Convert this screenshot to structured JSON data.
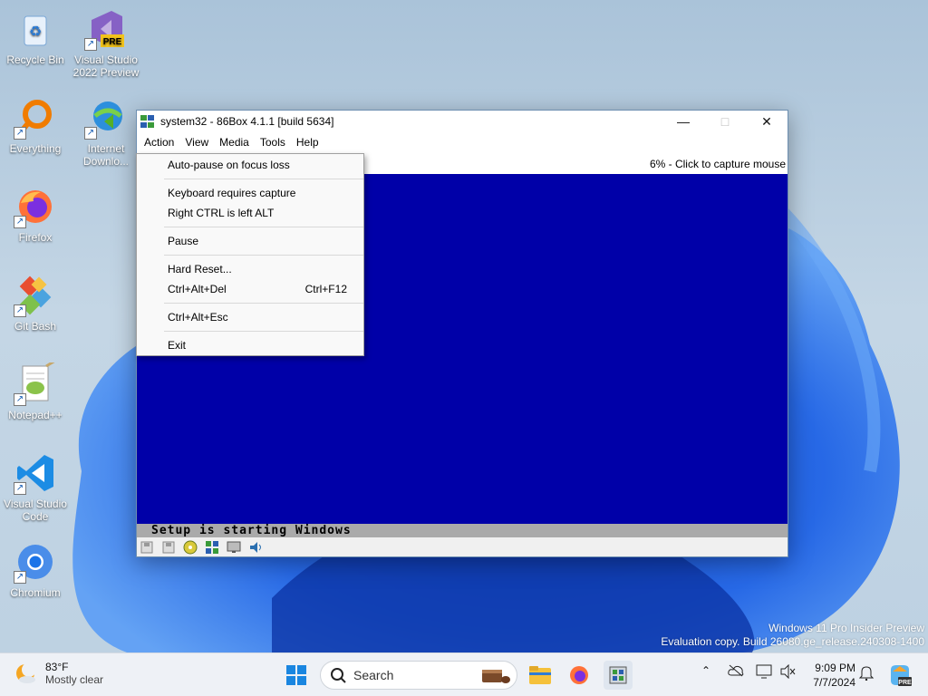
{
  "desktop": {
    "icons": [
      {
        "label": "Recycle Bin"
      },
      {
        "label": "Visual Studio 2022 Preview"
      },
      {
        "label": "Everything"
      },
      {
        "label": "Internet Downlo..."
      },
      {
        "label": "Firefox"
      },
      {
        "label": "Git Bash"
      },
      {
        "label": "Notepad++"
      },
      {
        "label": "Visual Studio Code"
      },
      {
        "label": "Chromium"
      }
    ],
    "vs_badge": "PRE"
  },
  "window": {
    "title": "system32 - 86Box 4.1.1 [build 5634]",
    "menus": [
      "Action",
      "View",
      "Media",
      "Tools",
      "Help"
    ],
    "status_text": "6% - Click to capture mouse",
    "setup_text": "Setup is starting Windows"
  },
  "action_menu": {
    "items": [
      {
        "label": "Auto-pause on focus loss",
        "shortcut": ""
      },
      {
        "label": "Keyboard requires capture",
        "shortcut": ""
      },
      {
        "label": "Right CTRL is left ALT",
        "shortcut": ""
      },
      {
        "label": "Pause",
        "shortcut": ""
      },
      {
        "label": "Hard Reset...",
        "shortcut": ""
      },
      {
        "label": "Ctrl+Alt+Del",
        "shortcut": "Ctrl+F12"
      },
      {
        "label": "Ctrl+Alt+Esc",
        "shortcut": ""
      },
      {
        "label": "Exit",
        "shortcut": ""
      }
    ]
  },
  "watermark": {
    "line1": "Windows 11 Pro Insider Preview",
    "line2": "Evaluation copy. Build 26080.ge_release.240308-1400"
  },
  "taskbar": {
    "weather_temp": "83°F",
    "weather_cond": "Mostly clear",
    "search_placeholder": "Search",
    "time": "9:09 PM",
    "date": "7/7/2024",
    "copilot_badge": "PRE"
  },
  "colors": {
    "emulator_screen": "#0000a8",
    "setup_bar": "#aaaaaa",
    "taskbar": "#eef1f6"
  }
}
